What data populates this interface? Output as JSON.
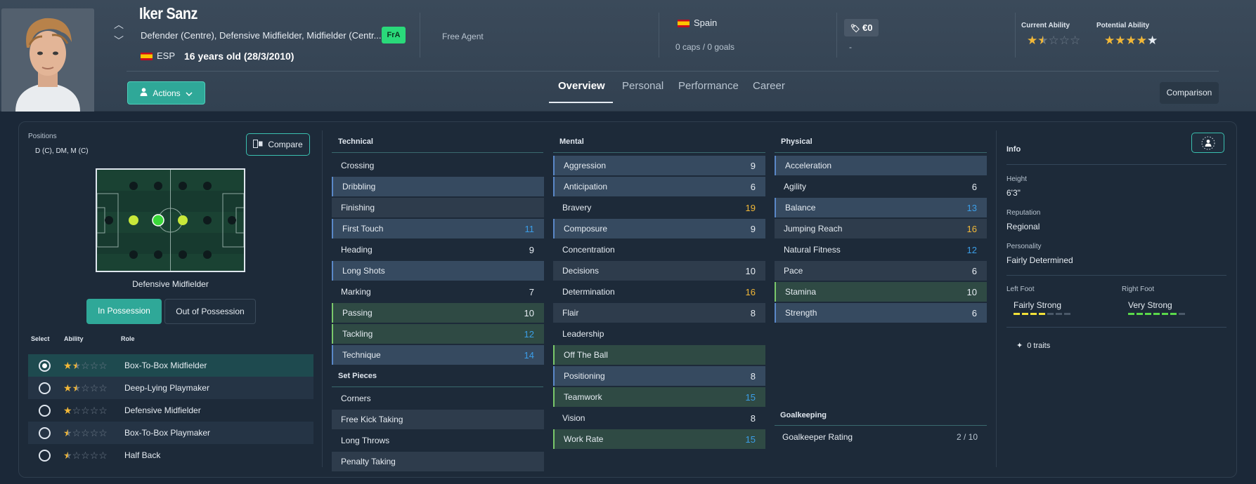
{
  "player": {
    "name": "Iker Sanz",
    "positions": "Defender (Centre), Defensive Midfielder, Midfielder (Centr...",
    "nationality_code": "ESP",
    "age": "16 years old (28/3/2010)",
    "badge": "FrA",
    "status": "Free Agent",
    "country": "Spain",
    "caps": "0 caps / 0 goals",
    "value": "€0",
    "value_sub": "-",
    "current_ability_label": "Current Ability",
    "potential_ability_label": "Potential Ability",
    "current_ability_stars": 1.5,
    "potential_ability_stars": 4
  },
  "header": {
    "actions_label": "Actions",
    "tabs": [
      "Overview",
      "Personal",
      "Performance",
      "Career"
    ],
    "active_tab": "Overview",
    "comparison_label": "Comparison"
  },
  "positions_panel": {
    "label": "Positions",
    "value": "D (C), DM, M (C)",
    "compare_label": "Compare",
    "selected_role": "Defensive Midfielder",
    "in_possession": "In Possession",
    "out_possession": "Out of Possession",
    "headers": {
      "select": "Select",
      "ability": "Ability",
      "role": "Role"
    },
    "roles": [
      {
        "name": "Box-To-Box Midfielder",
        "stars": 1.5,
        "selected": true
      },
      {
        "name": "Deep-Lying Playmaker",
        "stars": 1.5,
        "selected": false
      },
      {
        "name": "Defensive Midfielder",
        "stars": 1,
        "selected": false
      },
      {
        "name": "Box-To-Box Playmaker",
        "stars": 0.5,
        "selected": false
      },
      {
        "name": "Half Back",
        "stars": 0.5,
        "selected": false
      }
    ]
  },
  "technical": {
    "title": "Technical",
    "items": [
      {
        "name": "Crossing",
        "value": ""
      },
      {
        "name": "Dribbling",
        "value": ""
      },
      {
        "name": "Finishing",
        "value": ""
      },
      {
        "name": "First Touch",
        "value": "11"
      },
      {
        "name": "Heading",
        "value": "9"
      },
      {
        "name": "Long Shots",
        "value": ""
      },
      {
        "name": "Marking",
        "value": "7"
      },
      {
        "name": "Passing",
        "value": "10"
      },
      {
        "name": "Tackling",
        "value": "12"
      },
      {
        "name": "Technique",
        "value": "14"
      }
    ]
  },
  "set_pieces": {
    "title": "Set Pieces",
    "items": [
      {
        "name": "Corners",
        "value": ""
      },
      {
        "name": "Free Kick Taking",
        "value": ""
      },
      {
        "name": "Long Throws",
        "value": ""
      },
      {
        "name": "Penalty Taking",
        "value": ""
      }
    ]
  },
  "mental": {
    "title": "Mental",
    "items": [
      {
        "name": "Aggression",
        "value": "9"
      },
      {
        "name": "Anticipation",
        "value": "6"
      },
      {
        "name": "Bravery",
        "value": "19"
      },
      {
        "name": "Composure",
        "value": "9"
      },
      {
        "name": "Concentration",
        "value": ""
      },
      {
        "name": "Decisions",
        "value": "10"
      },
      {
        "name": "Determination",
        "value": "16"
      },
      {
        "name": "Flair",
        "value": "8"
      },
      {
        "name": "Leadership",
        "value": ""
      },
      {
        "name": "Off The Ball",
        "value": ""
      },
      {
        "name": "Positioning",
        "value": "8"
      },
      {
        "name": "Teamwork",
        "value": "15"
      },
      {
        "name": "Vision",
        "value": "8"
      },
      {
        "name": "Work Rate",
        "value": "15"
      }
    ]
  },
  "physical": {
    "title": "Physical",
    "items": [
      {
        "name": "Acceleration",
        "value": ""
      },
      {
        "name": "Agility",
        "value": "6"
      },
      {
        "name": "Balance",
        "value": "13"
      },
      {
        "name": "Jumping Reach",
        "value": "16"
      },
      {
        "name": "Natural Fitness",
        "value": "12"
      },
      {
        "name": "Pace",
        "value": "6"
      },
      {
        "name": "Stamina",
        "value": "10"
      },
      {
        "name": "Strength",
        "value": "6"
      }
    ]
  },
  "goalkeeping": {
    "title": "Goalkeeping",
    "rating_label": "Goalkeeper Rating",
    "rating_value": "2 / 10"
  },
  "info": {
    "title": "Info",
    "height_label": "Height",
    "height": "6'3\"",
    "reputation_label": "Reputation",
    "reputation": "Regional",
    "personality_label": "Personality",
    "personality": "Fairly Determined",
    "left_foot_label": "Left Foot",
    "left_foot": "Fairly Strong",
    "left_foot_level": 4,
    "right_foot_label": "Right Foot",
    "right_foot": "Very Strong",
    "right_foot_level": 6,
    "traits": "0 traits"
  },
  "colors": {
    "accent": "#2fa898",
    "star": "#f2b838",
    "value_blue": "#3b9ee8",
    "value_orange": "#f2b838",
    "foot_left": "#f2e038",
    "foot_right": "#5ad84a"
  }
}
